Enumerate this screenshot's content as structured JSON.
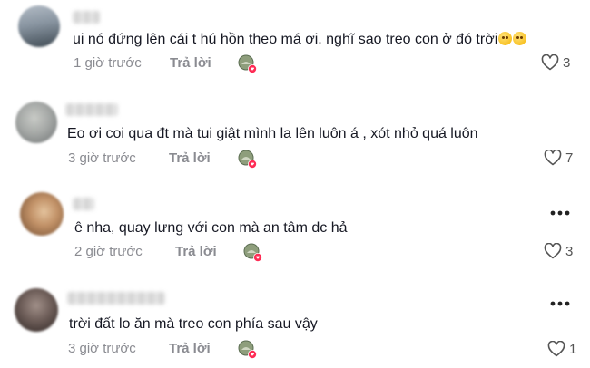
{
  "comments": [
    {
      "text": "ui nó đứng lên cái t hú hồn theo má ơi. nghĩ sao treo con ở đó trời",
      "emoji": "flushed-face-icon",
      "time": "1 giờ trước",
      "reply_label": "Trả lời",
      "likes": "3",
      "avatar_colors": [
        "#9aa3ad",
        "#4d5963"
      ]
    },
    {
      "text": "Eo ơi coi qua đt mà tui giật mình la lên luôn á , xót nhỏ quá luôn",
      "time": "3 giờ trước",
      "reply_label": "Trả lời",
      "likes": "7",
      "avatar_colors": [
        "#b9bbb8",
        "#7b7f80"
      ]
    },
    {
      "text": "ê nha, quay lưng với con mà an tâm dc hả",
      "time": "2 giờ trước",
      "reply_label": "Trả lời",
      "likes": "3",
      "avatar_colors": [
        "#d9b48a",
        "#8c5a35"
      ]
    },
    {
      "text": "trời đất lo ăn mà treo con phía sau vậy",
      "time": "3 giờ trước",
      "reply_label": "Trả lời",
      "likes": "1",
      "avatar_colors": [
        "#8b7a75",
        "#3a302e"
      ]
    }
  ],
  "icons": {
    "like": "heart-outline-icon",
    "more": "more-dots-icon",
    "creator": "creator-liked-badge-icon"
  },
  "colors": {
    "text": "#161823",
    "meta": "#8a8b91",
    "badge_heart": "#fe2c55"
  }
}
